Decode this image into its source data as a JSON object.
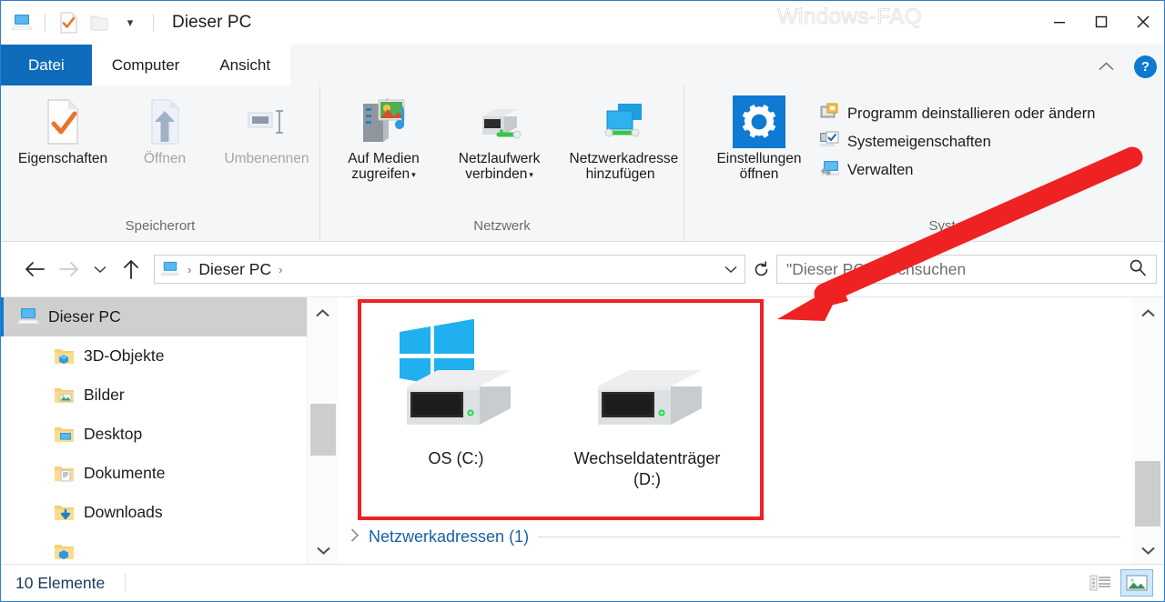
{
  "window": {
    "title": "Dieser PC",
    "watermark": "Windows-FAQ",
    "minimize": "–",
    "maximize": "☐",
    "close": "✕"
  },
  "quick_access": {
    "pc_icon": "this-pc-icon",
    "properties_icon": "properties-icon",
    "folder_icon": "folder-icon",
    "dropdown": "▾"
  },
  "tabs": [
    {
      "label": "Datei",
      "active": false,
      "file": true
    },
    {
      "label": "Computer",
      "active": true,
      "file": false
    },
    {
      "label": "Ansicht",
      "active": false,
      "file": false
    }
  ],
  "ribbon_right": {
    "collapse": "⌃",
    "help": "?"
  },
  "ribbon": {
    "groups": [
      {
        "label": "Speicherort",
        "buttons": [
          {
            "label": "Eigenschaften",
            "icon": "properties-icon",
            "disabled": false,
            "caret": false
          },
          {
            "label": "Öffnen",
            "icon": "open-icon",
            "disabled": true,
            "caret": false
          },
          {
            "label": "Umbenennen",
            "icon": "rename-icon",
            "disabled": true,
            "caret": false
          }
        ]
      },
      {
        "label": "Netzwerk",
        "buttons": [
          {
            "label_line1": "Auf Medien",
            "label_line2": "zugreifen",
            "icon": "media-server-icon",
            "disabled": false,
            "caret": true
          },
          {
            "label_line1": "Netzlaufwerk",
            "label_line2": "verbinden",
            "icon": "network-drive-icon",
            "disabled": false,
            "caret": true
          },
          {
            "label_line1": "Netzwerkadresse",
            "label_line2": "hinzufügen",
            "icon": "network-address-icon",
            "disabled": false,
            "caret": false
          }
        ]
      },
      {
        "label": "System",
        "big_button": {
          "label_line1": "Einstellungen",
          "label_line2": "öffnen",
          "icon": "settings-gear-icon"
        },
        "items": [
          {
            "label": "Programm deinstallieren oder ändern",
            "icon": "uninstall-program-icon"
          },
          {
            "label": "Systemeigenschaften",
            "icon": "system-properties-icon"
          },
          {
            "label": "Verwalten",
            "icon": "manage-icon"
          }
        ]
      }
    ]
  },
  "nav": {
    "back": "←",
    "forward": "→",
    "recent": "⌵",
    "up": "↑",
    "refresh": "↻",
    "crumb_dropdown": "⌵",
    "breadcrumb": [
      {
        "label": "Dieser PC",
        "icon": "this-pc-icon"
      }
    ],
    "crumb_sep": "›"
  },
  "search": {
    "placeholder": "\"Dieser PC\" durchsuchen",
    "icon": "search-icon"
  },
  "sidebar": {
    "items": [
      {
        "label": "Dieser PC",
        "icon": "this-pc-icon",
        "selected": true,
        "child": false
      },
      {
        "label": "3D-Objekte",
        "icon": "folder-3d-icon",
        "selected": false,
        "child": true
      },
      {
        "label": "Bilder",
        "icon": "folder-pictures-icon",
        "selected": false,
        "child": true
      },
      {
        "label": "Desktop",
        "icon": "folder-desktop-icon",
        "selected": false,
        "child": true
      },
      {
        "label": "Dokumente",
        "icon": "folder-documents-icon",
        "selected": false,
        "child": true
      },
      {
        "label": "Downloads",
        "icon": "folder-downloads-icon",
        "selected": false,
        "child": true
      },
      {
        "label": "",
        "icon": "folder-icon",
        "selected": false,
        "child": true
      }
    ],
    "scroll_up": "⌃",
    "scroll_down": "⌄"
  },
  "content": {
    "drives": [
      {
        "label": "OS (C:)",
        "icon": "windows-drive-icon",
        "has_windows_logo": true
      },
      {
        "label": "Wechseldatenträger (D:)",
        "icon": "removable-drive-icon",
        "has_windows_logo": false
      }
    ],
    "group_header": {
      "label": "Netzwerkadressen (1)",
      "chevron": "›"
    },
    "scroll_up": "⌃",
    "scroll_down": "⌄"
  },
  "status": {
    "item_count": "10 Elemente",
    "views": [
      {
        "name": "details-view",
        "active": false
      },
      {
        "name": "large-icons-view",
        "active": true
      }
    ]
  },
  "colors": {
    "accent": "#0f6cbd",
    "file_tab": "#0f6cbd",
    "annotation_red": "#ee2222",
    "link_blue": "#1a5fa8",
    "status_text": "#1b3a5e",
    "selection_grey": "#cfcfcf",
    "ribbon_bg": "#f5f6f7"
  }
}
